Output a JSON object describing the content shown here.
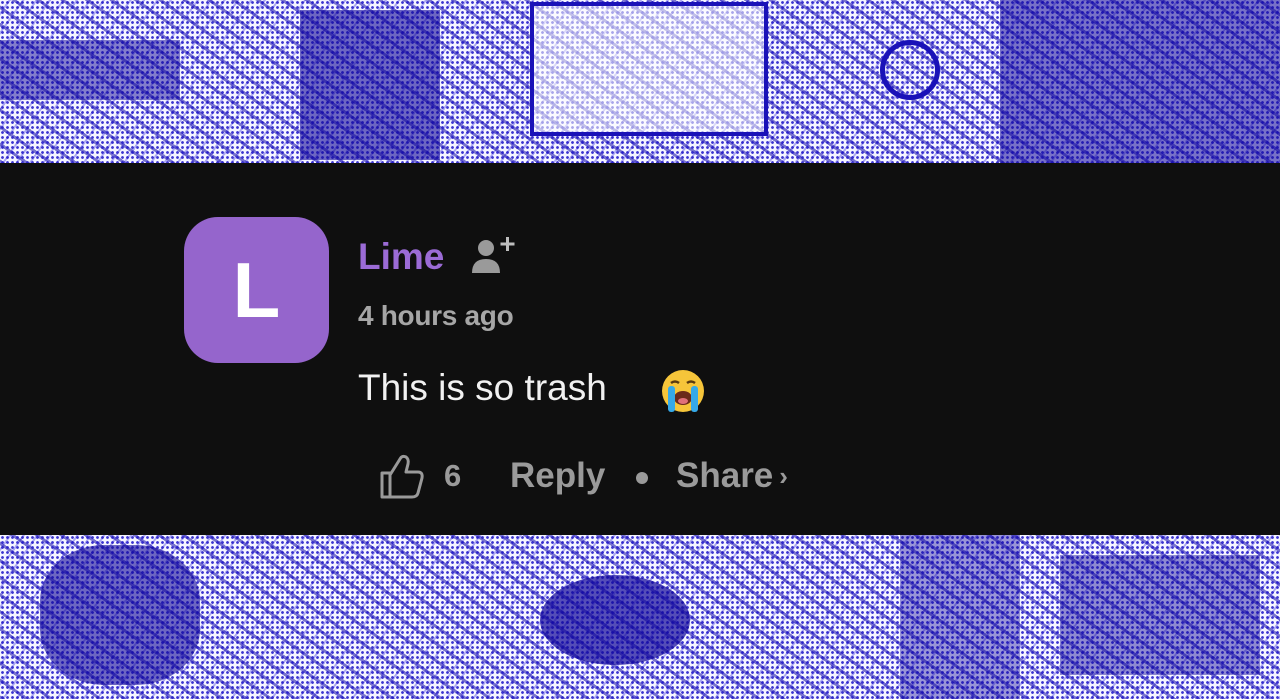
{
  "comment": {
    "avatar_letter": "L",
    "avatar_color": "#9565cc",
    "username": "Lime",
    "username_color": "#9b6bd6",
    "add_friend_icon": "person-add-icon",
    "timestamp": "4 hours ago",
    "text": "This is so trash",
    "emoji_icon": "loudly-crying-face-emoji",
    "like_icon": "thumbs-up-icon",
    "like_count": "6",
    "reply_label": "Reply",
    "share_label": "Share",
    "share_chevron": "›"
  },
  "theme": {
    "background": "#0f0f0f",
    "muted_text": "#9a9a9a",
    "banner_accent": "#1a12b8"
  }
}
